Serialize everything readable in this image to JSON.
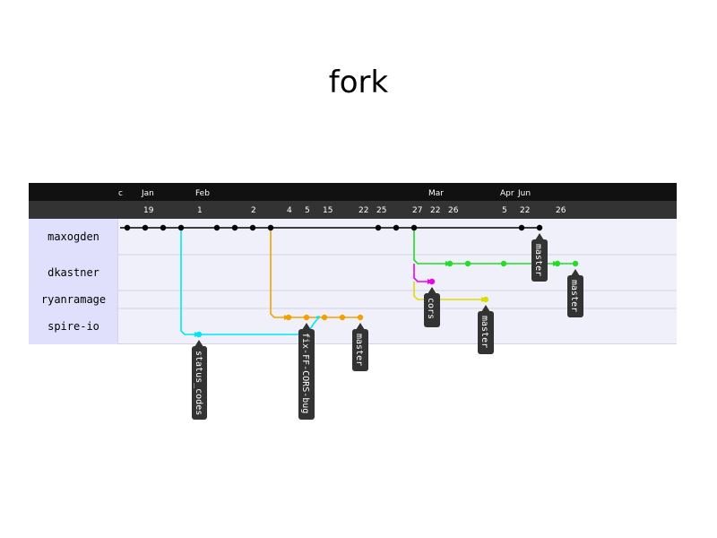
{
  "title": "fork",
  "header": {
    "c_label": "c",
    "months": [
      {
        "label": "Jan",
        "col": 1
      },
      {
        "label": "Feb",
        "col": 4
      },
      {
        "label": "Mar",
        "col": 17
      },
      {
        "label": "Apr",
        "col": 21
      },
      {
        "label": "Jun",
        "col": 22
      }
    ],
    "days": [
      {
        "label": "19",
        "col": 1
      },
      {
        "label": "1",
        "col": 4
      },
      {
        "label": "2",
        "col": 7
      },
      {
        "label": "4",
        "col": 9
      },
      {
        "label": "5",
        "col": 10
      },
      {
        "label": "15",
        "col": 11
      },
      {
        "label": "22",
        "col": 13
      },
      {
        "label": "25",
        "col": 14
      },
      {
        "label": "27",
        "col": 16
      },
      {
        "label": "22",
        "col": 17
      },
      {
        "label": "26",
        "col": 18
      },
      {
        "label": "5",
        "col": 21
      },
      {
        "label": "22",
        "col": 22
      },
      {
        "label": "26",
        "col": 24
      }
    ]
  },
  "rows": [
    "maxogden",
    "dkastner",
    "ryanramage",
    "spire-io"
  ],
  "colors": {
    "maxogden": "#000000",
    "status_codes": "#00e8ee",
    "fix_ff": "#f5a000",
    "dkastner": "#22dd22",
    "cors": "#ee00ee",
    "ryanramage": "#dddd00",
    "header_bg": "#111111",
    "subheader_bg": "#333333",
    "row_bg": "#f0f0fa",
    "label_bg": "#e0e0fc"
  },
  "tags": [
    "status_codes",
    "fix-FF-CORS-bug",
    "master",
    "cors",
    "master",
    "master",
    "master"
  ]
}
